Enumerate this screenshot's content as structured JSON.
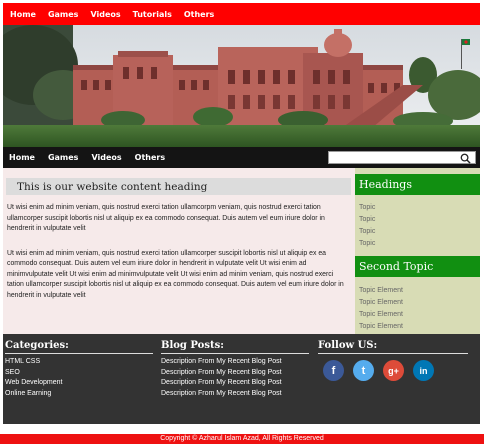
{
  "top_nav": [
    "Home",
    "Games",
    "Videos",
    "Tutorials",
    "Others"
  ],
  "sub_nav": [
    "Home",
    "Games",
    "Videos",
    "Others"
  ],
  "search": {
    "placeholder": "",
    "value": ""
  },
  "main": {
    "heading": "This is our website content heading",
    "paragraph1": "Ut wisi enim ad minim veniam, quis nostrud exerci tation ullamcorpm veniam, quis nostrud exerci tation ullamcorper suscipit lobortis nisl ut aliquip ex ea commodo consequat. Duis autem vel eum iriure dolor in hendrerit in vulputate velit",
    "paragraph2": "Ut wisi enim ad minim veniam, quis nostrud exerci tation ullamcorper suscipit lobortis nisl ut aliquip ex ea commodo consequat. Duis autem vel eum iriure dolor in hendrerit in vulputate velit Ut wisi enim ad minimvulputate velit Ut wisi enim ad minimvulputate velit Ut wisi enim ad minim veniam, quis nostrud exerci tation ullamcorper suscipit lobortis nisl ut aliquip ex ea commodo consequat. Duis autem vel eum iriure dolor in hendrerit in vulputate velit"
  },
  "sidebar": {
    "heading1": "Headings",
    "topics": [
      "Topic",
      "Topic",
      "Topic",
      "Topic"
    ],
    "heading2": "Second Topic",
    "elements": [
      "Topic Element",
      "Topic Element",
      "Topic Element",
      "Topic Element"
    ]
  },
  "footer": {
    "categories_title": "Categories:",
    "categories": [
      "HTML CSS",
      "SEO",
      "Web Development",
      "Online Earning"
    ],
    "blog_title": "Blog Posts:",
    "blog_posts": [
      "Description From My Recent Blog Post",
      "Description From My Recent Blog Post",
      "Description From My Recent Blog Post",
      "Description From My Recent Blog Post"
    ],
    "follow_title": "Follow US:",
    "social": [
      {
        "icon": "facebook-icon",
        "glyph": "f",
        "color": "#3b5998"
      },
      {
        "icon": "twitter-icon",
        "glyph": "t",
        "color": "#55acee"
      },
      {
        "icon": "google-plus-icon",
        "glyph": "g+",
        "color": "#dd4b39"
      },
      {
        "icon": "linkedin-icon",
        "glyph": "in",
        "color": "#0077b5"
      }
    ]
  },
  "copyright": "Copyright © Azharul Islam Azad, All Rights Reserved",
  "colors": {
    "top_nav": "#ff0000",
    "sub_nav": "#141414",
    "sidebar_heading": "#118f11",
    "sidebar_bg": "#d8dcb5",
    "main_bg": "#f6eaea",
    "footer": "#333333"
  }
}
